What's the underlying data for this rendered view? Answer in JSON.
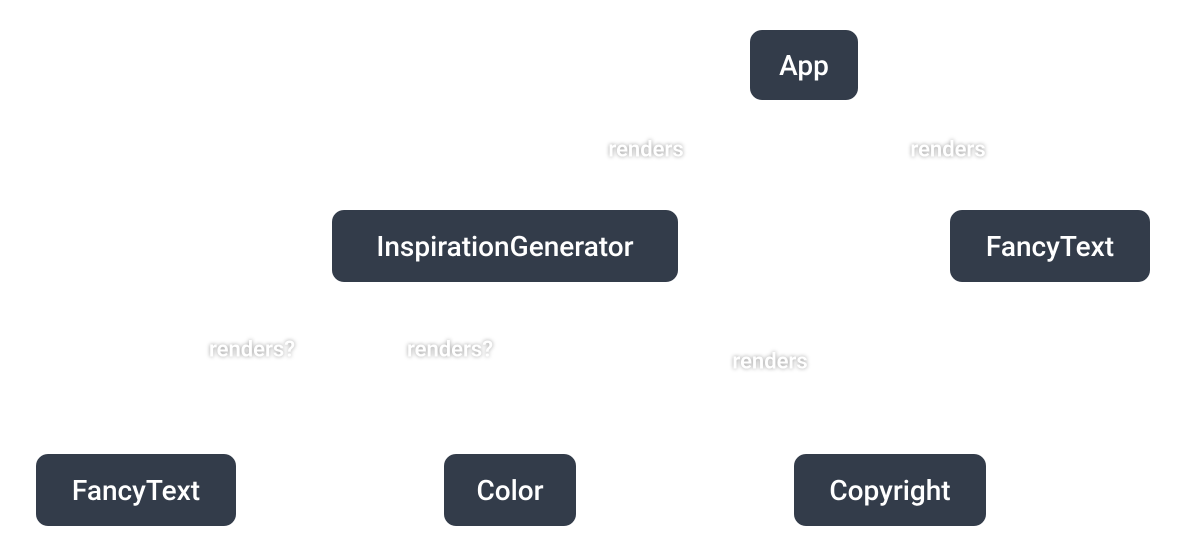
{
  "diagram": {
    "nodes": {
      "app": {
        "label": "App"
      },
      "ig": {
        "label": "InspirationGenerator"
      },
      "ftRight": {
        "label": "FancyText"
      },
      "ftLeft": {
        "label": "FancyText"
      },
      "color": {
        "label": "Color"
      },
      "copyright": {
        "label": "Copyright"
      }
    },
    "edges": {
      "app_ig": {
        "label": "renders",
        "style": "solid"
      },
      "app_ftRight": {
        "label": "renders",
        "style": "solid"
      },
      "ig_ftLeft": {
        "label": "renders?",
        "style": "dashed"
      },
      "ig_color": {
        "label": "renders?",
        "style": "dashed"
      },
      "ig_copyright": {
        "label": "renders",
        "style": "solid"
      }
    }
  }
}
